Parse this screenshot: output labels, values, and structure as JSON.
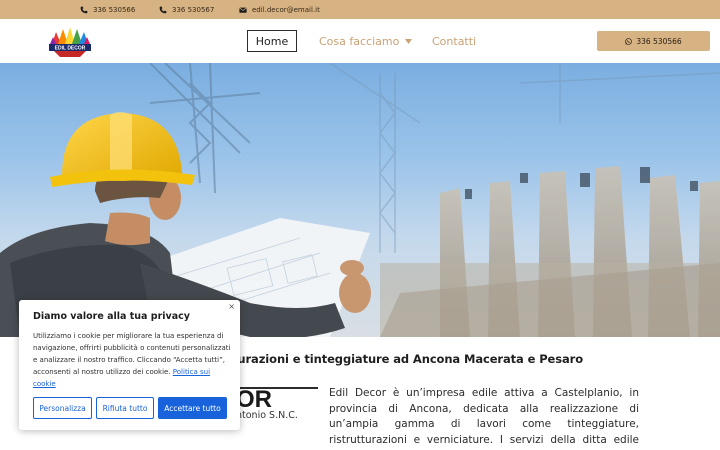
{
  "topbar": {
    "phone1": "336 530566",
    "phone2": "336 530567",
    "email": "edil.decor@email.it"
  },
  "header": {
    "logo_text": "EDIL DECOR",
    "nav": {
      "home": "Home",
      "services": "Cosa facciamo",
      "contacts": "Contatti"
    },
    "phone_button": "336 530566"
  },
  "hero": {
    "image": "architect-with-hard-hat-and-blueprints"
  },
  "content": {
    "tagline": "turazioni e tinteggiature ad Ancona Macerata e Pesaro",
    "brand_big": "OR",
    "brand_sub": "ntonio S.N.C.",
    "intro": "Edil Decor è un’impresa edile attiva a Castelplanio, in provincia di Ancona, dedicata alla realizzazione di un’ampia gamma di lavori come tinteggiature, ristrutturazioni e verniciature. I servizi della ditta edile sono dedicati sia al"
  },
  "cookie": {
    "title": "Diamo valore alla tua privacy",
    "body": "Utilizziamo i cookie per migliorare la tua esperienza di navigazione, offrirti pubblicità o contenuti personalizzati e analizzare il nostro traffico. Cliccando “Accetta tutti”, acconsenti al nostro utilizzo dei cookie.",
    "link": "Politica sui cookie",
    "customize": "Personalizza",
    "reject": "Rifiuta tutto",
    "accept": "Accettare tutto",
    "close": "×"
  },
  "colors": {
    "brand_tan": "#d7b384",
    "nav_inactive": "#c9a173",
    "cookie_blue": "#1863dc"
  }
}
